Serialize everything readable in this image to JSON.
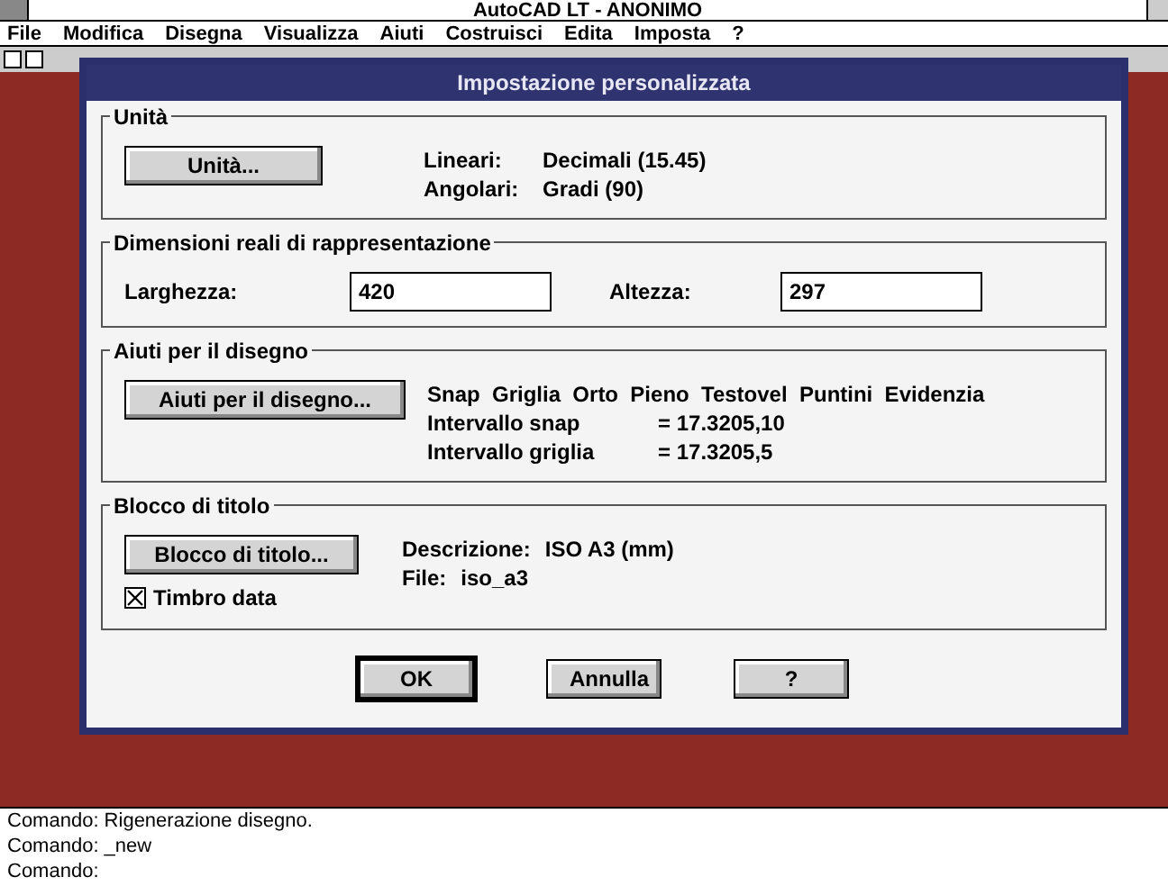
{
  "window": {
    "title": "AutoCAD LT - ANONIMO"
  },
  "menu": [
    "File",
    "Modifica",
    "Disegna",
    "Visualizza",
    "Aiuti",
    "Costruisci",
    "Edita",
    "Imposta",
    "?"
  ],
  "dialog": {
    "title": "Impostazione personalizzata",
    "units": {
      "legend": "Unità",
      "button": "Unità...",
      "lines": [
        {
          "label": "Lineari:",
          "value": "Decimali (15.45)"
        },
        {
          "label": "Angolari:",
          "value": "Gradi (90)"
        }
      ]
    },
    "size": {
      "legend": "Dimensioni reali di rappresentazione",
      "fields": [
        {
          "label": "Larghezza:",
          "value": "420"
        },
        {
          "label": "Altezza:",
          "value": "297"
        }
      ]
    },
    "aids": {
      "legend": "Aiuti per il disegno",
      "button": "Aiuti per il disegno...",
      "modes": "Snap  Griglia  Orto  Pieno  Testovel  Puntini  Evidenzia",
      "lines": [
        {
          "label": "Intervallo snap",
          "value": "= 17.3205,10"
        },
        {
          "label": "Intervallo griglia",
          "value": "= 17.3205,5"
        }
      ]
    },
    "title_block": {
      "legend": "Blocco di titolo",
      "button": "Blocco di titolo...",
      "checkbox": {
        "label": "Timbro data",
        "checked": true
      },
      "lines": [
        {
          "label": "Descrizione:",
          "value": "ISO A3 (mm)"
        },
        {
          "label": "File:",
          "value": "iso_a3"
        }
      ]
    },
    "buttons": [
      {
        "label": "OK",
        "default": true
      },
      {
        "label": "Annulla",
        "default": false
      },
      {
        "label": "?",
        "default": false
      }
    ]
  },
  "command_lines": [
    "Comando: Rigenerazione disegno.",
    "Comando: _new",
    "Comando:"
  ]
}
